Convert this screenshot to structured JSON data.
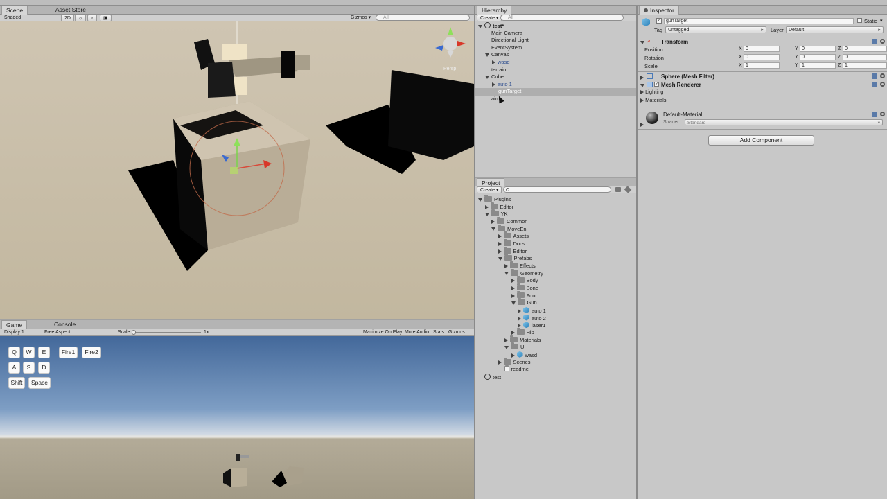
{
  "scene": {
    "tabs": [
      "Scene",
      "Asset Store"
    ],
    "shading": "Shaded",
    "mode2d": "2D",
    "gizmos": "Gizmos",
    "search_placeholder": "All",
    "persp": "Persp"
  },
  "game": {
    "tabs": [
      "Game",
      "Console"
    ],
    "display": "Display 1",
    "aspect": "Free Aspect",
    "scale_label": "Scale",
    "scale_value": "1x",
    "options": [
      "Maximize On Play",
      "Mute Audio",
      "Stats",
      "Gizmos"
    ],
    "keys": [
      "Q",
      "W",
      "E",
      "Fire1",
      "Fire2",
      "A",
      "S",
      "D",
      "Shift",
      "Space"
    ]
  },
  "hierarchy": {
    "tab": "Hierarchy",
    "create": "Create",
    "search_placeholder": "All",
    "items": [
      {
        "label": "test*",
        "depth": 0,
        "arrow": "down",
        "icon": "unity"
      },
      {
        "label": "Main Camera",
        "depth": 1,
        "arrow": ""
      },
      {
        "label": "Directional Light",
        "depth": 1,
        "arrow": ""
      },
      {
        "label": "EventSystem",
        "depth": 1,
        "arrow": ""
      },
      {
        "label": "Canvas",
        "depth": 1,
        "arrow": "down"
      },
      {
        "label": "wasd",
        "depth": 2,
        "arrow": "right",
        "color": "#2f4f8f"
      },
      {
        "label": "terrain",
        "depth": 1,
        "arrow": ""
      },
      {
        "label": "Cube",
        "depth": 1,
        "arrow": "down"
      },
      {
        "label": "auto 1",
        "depth": 2,
        "arrow": "right",
        "color": "#2f4f8f"
      },
      {
        "label": "gunTarget",
        "depth": 2,
        "arrow": "",
        "selected": true
      },
      {
        "label": "aim",
        "depth": 1,
        "arrow": ""
      }
    ]
  },
  "project": {
    "tab": "Project",
    "create": "Create",
    "items": [
      {
        "label": "Plugins",
        "depth": 0,
        "arrow": "down",
        "icon": "folder"
      },
      {
        "label": "Editor",
        "depth": 1,
        "arrow": "right",
        "icon": "folder"
      },
      {
        "label": "YK",
        "depth": 1,
        "arrow": "down",
        "icon": "folder"
      },
      {
        "label": "Common",
        "depth": 2,
        "arrow": "right",
        "icon": "folder"
      },
      {
        "label": "MoveEn",
        "depth": 2,
        "arrow": "down",
        "icon": "folder"
      },
      {
        "label": "Assets",
        "depth": 3,
        "arrow": "right",
        "icon": "folder"
      },
      {
        "label": "Docs",
        "depth": 3,
        "arrow": "right",
        "icon": "folder"
      },
      {
        "label": "Editor",
        "depth": 3,
        "arrow": "right",
        "icon": "folder"
      },
      {
        "label": "Prefabs",
        "depth": 3,
        "arrow": "down",
        "icon": "folder"
      },
      {
        "label": "Effects",
        "depth": 4,
        "arrow": "right",
        "icon": "folder"
      },
      {
        "label": "Geometry",
        "depth": 4,
        "arrow": "down",
        "icon": "folder"
      },
      {
        "label": "Body",
        "depth": 5,
        "arrow": "right",
        "icon": "folder"
      },
      {
        "label": "Bone",
        "depth": 5,
        "arrow": "right",
        "icon": "folder"
      },
      {
        "label": "Foot",
        "depth": 5,
        "arrow": "right",
        "icon": "folder"
      },
      {
        "label": "Gun",
        "depth": 5,
        "arrow": "down",
        "icon": "folder"
      },
      {
        "label": "auto 1",
        "depth": 6,
        "arrow": "right",
        "icon": "cube"
      },
      {
        "label": "auto 2",
        "depth": 6,
        "arrow": "right",
        "icon": "cube"
      },
      {
        "label": "laser1",
        "depth": 6,
        "arrow": "right",
        "icon": "cube"
      },
      {
        "label": "Hip",
        "depth": 5,
        "arrow": "right",
        "icon": "folder"
      },
      {
        "label": "Materials",
        "depth": 4,
        "arrow": "right",
        "icon": "folder"
      },
      {
        "label": "UI",
        "depth": 4,
        "arrow": "down",
        "icon": "folder"
      },
      {
        "label": "wasd",
        "depth": 5,
        "arrow": "right",
        "icon": "cube"
      },
      {
        "label": "Scenes",
        "depth": 3,
        "arrow": "right",
        "icon": "folder"
      },
      {
        "label": "readme",
        "depth": 3,
        "arrow": "",
        "icon": "doc"
      },
      {
        "label": "test",
        "depth": 0,
        "arrow": "",
        "icon": "unity"
      }
    ]
  },
  "inspector": {
    "tab": "Inspector",
    "object_name": "gunTarget",
    "static_label": "Static",
    "tag_label": "Tag",
    "tag_value": "Untagged",
    "layer_label": "Layer",
    "layer_value": "Default",
    "transform": {
      "title": "Transform",
      "rows": [
        {
          "label": "Position",
          "x": "0",
          "y": "0",
          "z": "0"
        },
        {
          "label": "Rotation",
          "x": "0",
          "y": "0",
          "z": "0"
        },
        {
          "label": "Scale",
          "x": "1",
          "y": "1",
          "z": "1"
        }
      ]
    },
    "mesh_filter": "Sphere (Mesh Filter)",
    "mesh_renderer": "Mesh Renderer",
    "lighting": "Lighting",
    "materials": "Materials",
    "material_name": "Default-Material",
    "shader_label": "Shader",
    "shader_value": "Standard",
    "add_component": "Add Component",
    "axis_labels": {
      "x": "X",
      "y": "Y",
      "z": "Z"
    }
  }
}
